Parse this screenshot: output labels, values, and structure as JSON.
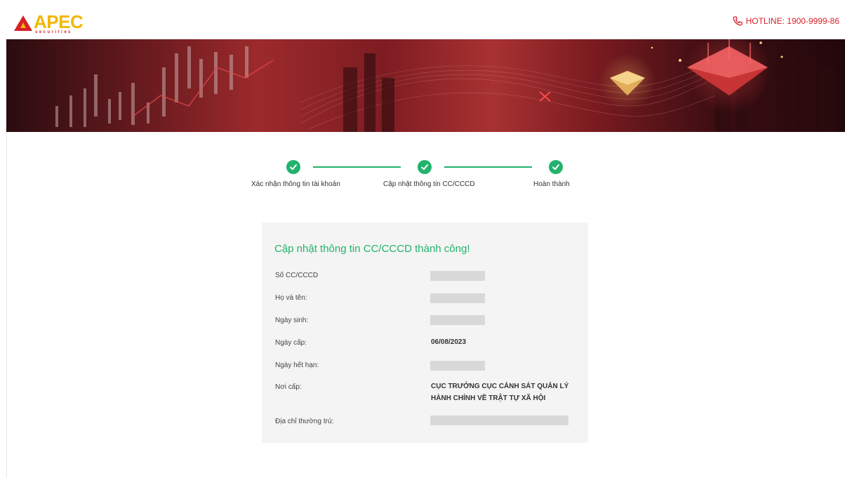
{
  "header": {
    "logo_text": "APEC",
    "logo_subtext": "securities",
    "hotline": "HOTLINE: 1900-9999-86",
    "icons": {
      "phone": "phone-icon"
    }
  },
  "steps": [
    {
      "label": "Xác nhận thông tin tài khoản",
      "status": "done"
    },
    {
      "label": "Cập nhật thông tin CC/CCCD",
      "status": "done"
    },
    {
      "label": "Hoàn thành",
      "status": "done"
    }
  ],
  "result": {
    "title": "Cập nhật thông tin CC/CCCD thành công!",
    "fields": [
      {
        "label": "Số CC/CCCD",
        "value": null,
        "redacted": true
      },
      {
        "label": "Họ và tên:",
        "value": null,
        "redacted": true
      },
      {
        "label": "Ngày sinh:",
        "value": null,
        "redacted": true
      },
      {
        "label": "Ngày cấp:",
        "value": "06/08/2023",
        "redacted": false
      },
      {
        "label": "Ngày hết hạn:",
        "value": null,
        "redacted": true
      },
      {
        "label": "Nơi cấp:",
        "value": "CỤC TRƯỞNG CỤC CẢNH SÁT QUẢN LÝ HÀNH CHÍNH VỀ TRẬT TỰ XÃ HỘI",
        "redacted": false
      },
      {
        "label": "Địa chỉ thường trú:",
        "value": null,
        "redacted": true
      }
    ]
  },
  "colors": {
    "accent_green": "#23b26d",
    "brand_red": "#d81f26",
    "brand_yellow": "#f2b705"
  }
}
